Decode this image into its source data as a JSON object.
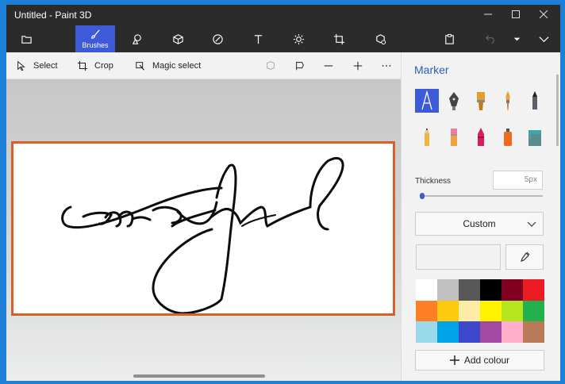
{
  "window": {
    "title": "Untitled - Paint 3D"
  },
  "toolbar": {
    "active_label": "Brushes"
  },
  "subbar": {
    "select": "Select",
    "crop": "Crop",
    "magic_select": "Magic select"
  },
  "panel": {
    "title": "Marker",
    "thickness_label": "Thickness",
    "thickness_value": "5px",
    "thickness_level": 0.0,
    "dropdown_value": "Custom",
    "add_colour": "Add colour"
  },
  "colors": {
    "accent": "#3d5bd8",
    "canvas_border": "#d8602a",
    "palette": [
      "#ffffff",
      "#c0c0c0",
      "#585858",
      "#000000",
      "#7f0020",
      "#ed1c24",
      "#ff7f27",
      "#ffc90e",
      "#fdeca6",
      "#fff200",
      "#b5e61d",
      "#22b14c",
      "#99d9ea",
      "#00a2e8",
      "#3f48cc",
      "#a349a4",
      "#ffaec9",
      "#b97a57"
    ]
  }
}
